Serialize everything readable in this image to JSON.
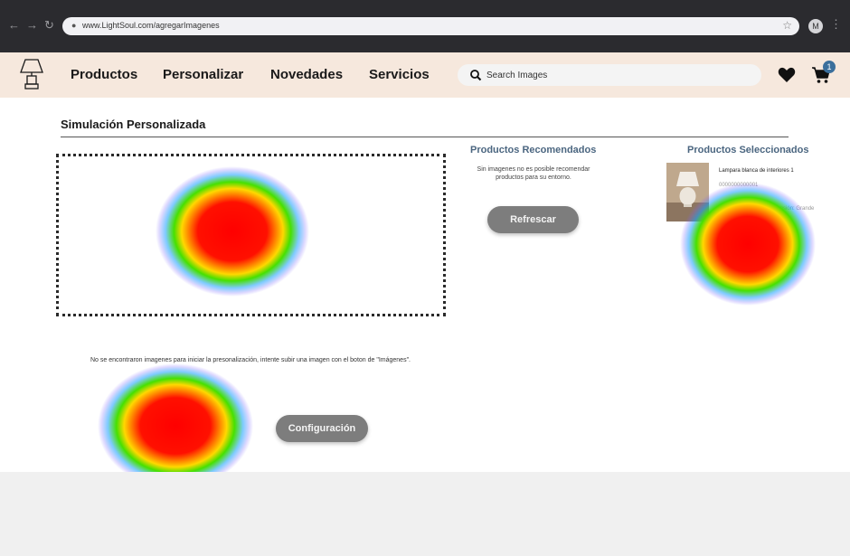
{
  "browser": {
    "url": "www.LightSoul.com/agregarImagenes",
    "profile_initial": "M"
  },
  "header": {
    "nav": [
      "Productos",
      "Personalizar",
      "Novedades",
      "Servicios"
    ],
    "search_placeholder": "Search Images",
    "cart_count": "1"
  },
  "main": {
    "title": "Simulación Personalizada",
    "recommended": {
      "title": "Productos Recomendados",
      "message": "Sin imagenes no es posible recomendar productos para su entorno.",
      "refresh_label": "Refrescar"
    },
    "selected": {
      "title": "Productos Seleccionados",
      "product_name": "Lampara blanca de interiores 1",
      "product_code": "0000000000001",
      "product_meta": "Medidas: 30x20x45   Dimensión: Grande"
    },
    "empty_message": "No se encontraron imagenes para iniciar la presonalización, intente subir una imagen con el boton de \"Imágenes\".",
    "config_label": "Configuración"
  },
  "colors": {
    "chrome": "#2b2b2f",
    "header_bg": "#f6e8dd",
    "accent_blue": "#4b6680",
    "button_gray": "#7d7d7d"
  },
  "icons": [
    "lamp-logo-icon",
    "search-icon",
    "heart-icon",
    "cart-icon",
    "lock-icon",
    "star-icon"
  ]
}
